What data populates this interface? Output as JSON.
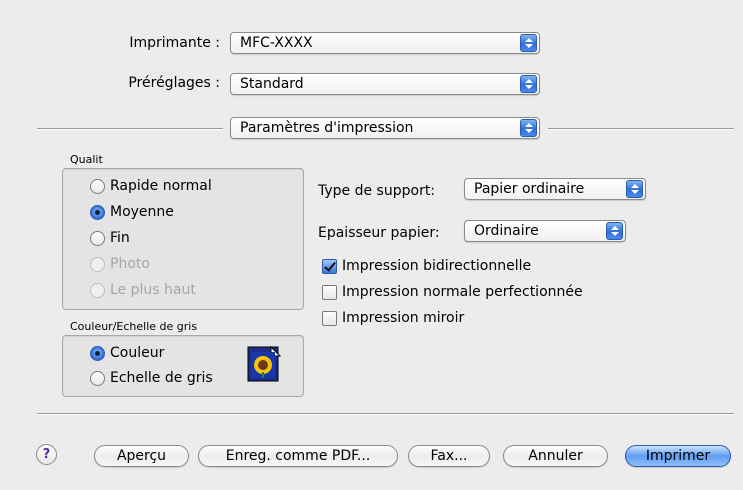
{
  "printer": {
    "label": "Imprimante :",
    "value": "MFC-XXXX"
  },
  "presets": {
    "label": "Préréglages :",
    "value": "Standard"
  },
  "panel": {
    "value": "Paramètres d'impression"
  },
  "quality": {
    "label": "Qualit",
    "options": [
      {
        "label": "Rapide normal",
        "selected": false,
        "enabled": true
      },
      {
        "label": "Moyenne",
        "selected": true,
        "enabled": true
      },
      {
        "label": "Fin",
        "selected": false,
        "enabled": true
      },
      {
        "label": "Photo",
        "selected": false,
        "enabled": false
      },
      {
        "label": "Le plus haut",
        "selected": false,
        "enabled": false
      }
    ]
  },
  "color": {
    "label": "Couleur/Echelle de gris",
    "options": [
      {
        "label": "Couleur",
        "selected": true
      },
      {
        "label": "Echelle de gris",
        "selected": false
      }
    ]
  },
  "media": {
    "label": "Type de support:",
    "value": "Papier ordinaire"
  },
  "thickness": {
    "label": "Epaisseur papier:",
    "value": "Ordinaire"
  },
  "checks": [
    {
      "label": "Impression bidirectionnelle",
      "checked": true
    },
    {
      "label": "Impression normale perfectionnée",
      "checked": false
    },
    {
      "label": "Impression miroir",
      "checked": false
    }
  ],
  "buttons": {
    "help": "?",
    "preview": "Aperçu",
    "save_pdf": "Enreg. comme PDF...",
    "fax": "Fax...",
    "cancel": "Annuler",
    "print": "Imprimer"
  }
}
